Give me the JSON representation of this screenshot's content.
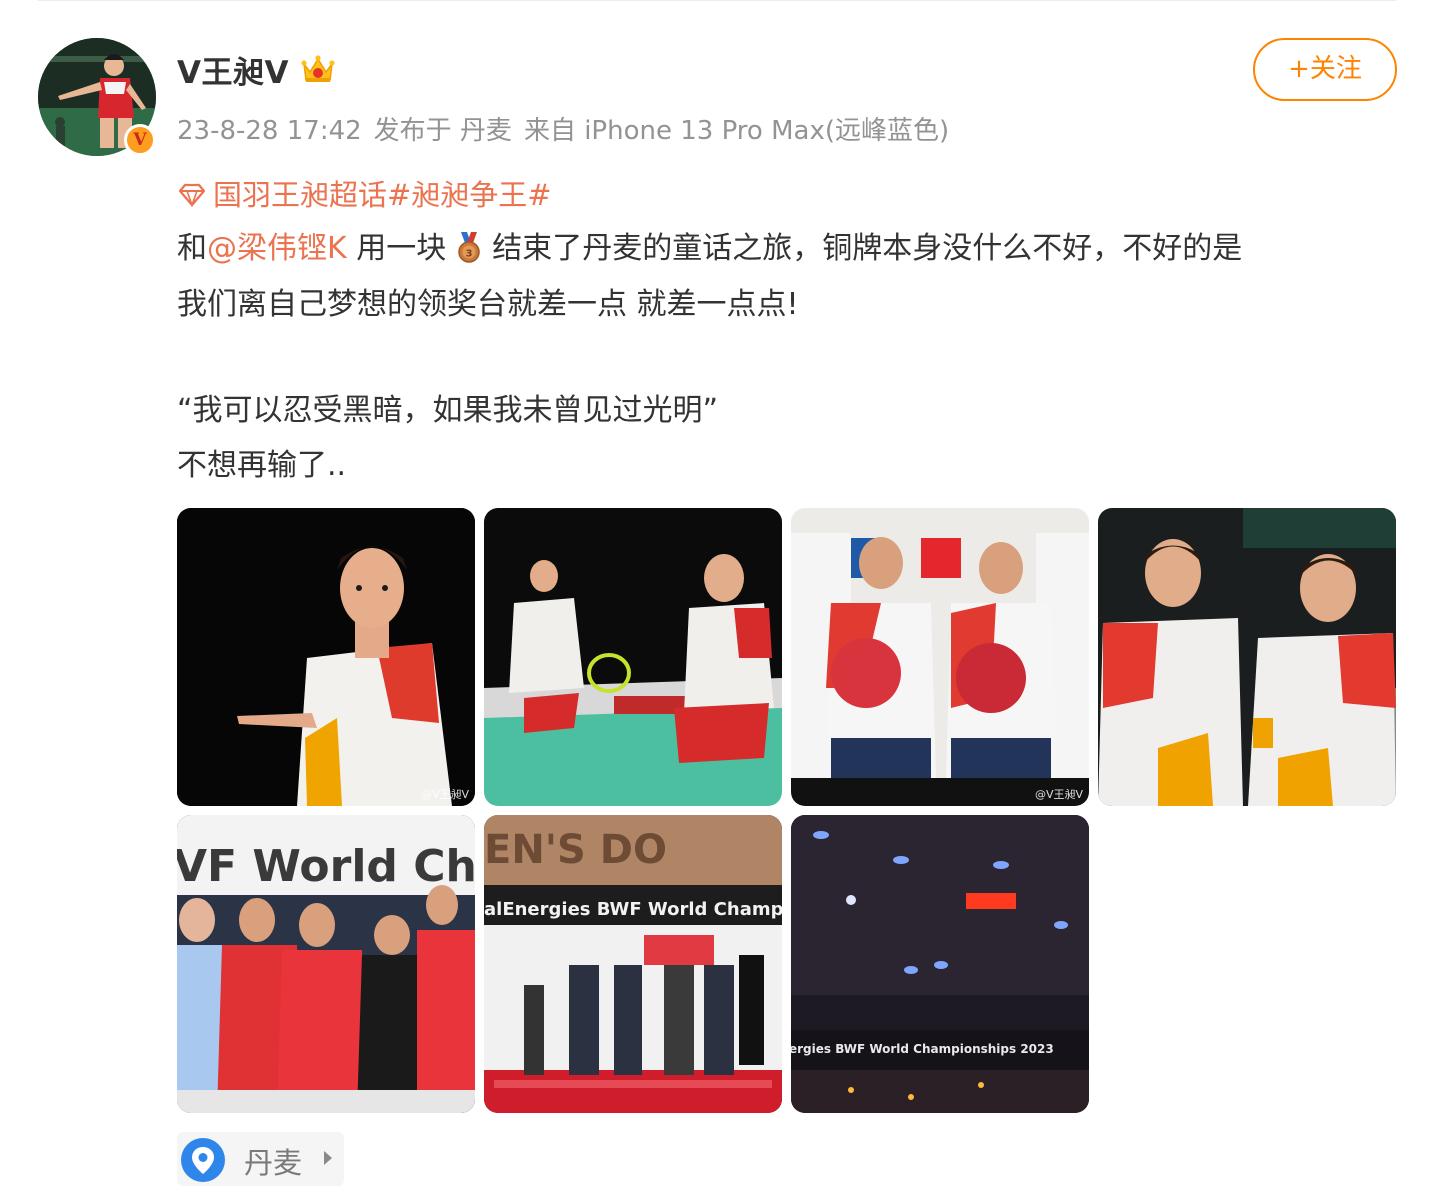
{
  "post": {
    "author": "V王昶V",
    "time": "23-8-28 17:42",
    "published_in": "发布于 丹麦",
    "source": "来自 iPhone 13 Pro Max(远峰蓝色)",
    "follow_label": "+关注",
    "topic_text": "国羽王昶超话#昶昶争王#",
    "content": {
      "line1_prefix": "和",
      "mention": "@梁伟铿K",
      "line1_mid": " 用一块",
      "line1_suffix": "结束了丹麦的童话之旅，铜牌本身没什么不好，不好的是",
      "line2": "我们离自己梦想的领奖台就差一点 就差一点点!",
      "line3": "“我可以忍受黑暗，如果我未曾见过光明”",
      "line4": "不想再输了.."
    },
    "photos": {
      "watermark_1": "@V王昶V",
      "watermark_3": "@V王昶V",
      "photo5_banner": "VF World Cha",
      "photo6_banner": "alEnergies BWF World Champion",
      "photo6_top": "EN'S DO",
      "photo7_banner": "ergies BWF World Championships 2023"
    },
    "location": {
      "label": "丹麦"
    }
  },
  "icons": {
    "verified": "verified-v-badge",
    "crown": "crown-icon",
    "topic": "diamond-topic-icon",
    "medal": "bronze-medal-emoji",
    "location": "location-pin-icon",
    "chevron": "chevron-right-icon"
  },
  "colors": {
    "accent": "#ff8200",
    "link": "#eb7350",
    "meta": "#939393",
    "text": "#333333",
    "location_pin": "#2f86ea"
  }
}
